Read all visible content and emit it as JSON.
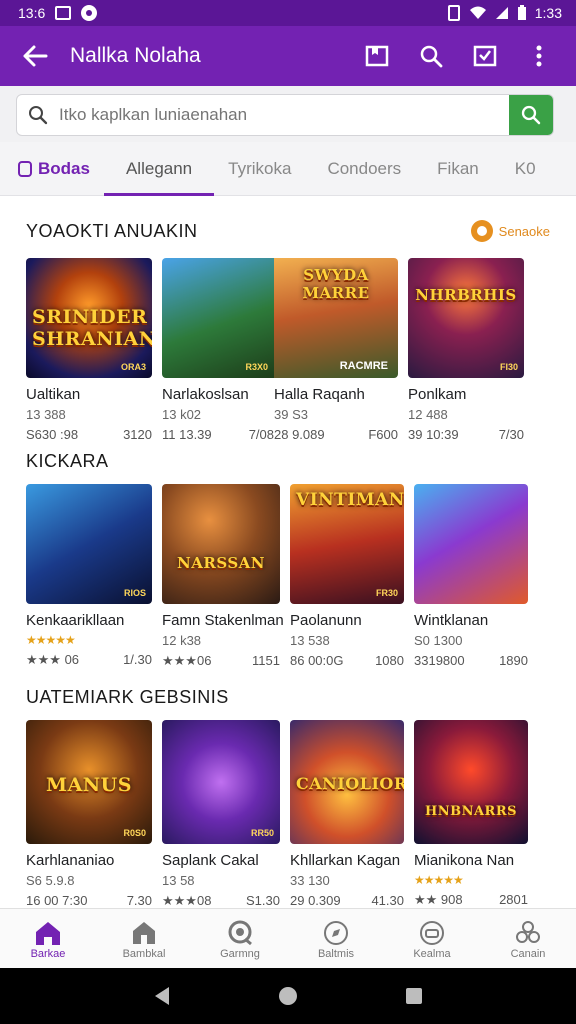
{
  "status_bar": {
    "time": "13:6",
    "right_time": "1:33"
  },
  "app_bar": {
    "title": "Nallka Nolaha"
  },
  "search": {
    "placeholder": "Itko kaplkan luniaenahan",
    "value": ""
  },
  "tabs": [
    {
      "label": "Bodas"
    },
    {
      "label": "Allegann"
    },
    {
      "label": "Tyrikoka"
    },
    {
      "label": "Condoers"
    },
    {
      "label": "Fikan"
    },
    {
      "label": "K0"
    }
  ],
  "sections": [
    {
      "title": "YOAOKTI ANUAKIN",
      "more_label": "Senaoke",
      "cards": [
        {
          "art": "SRINIDER SHRANIAN",
          "corner": "ORA3",
          "name": "Ualtikan",
          "sub": "13 388",
          "meta_left": "S630 :98",
          "meta_right": "3120"
        },
        {
          "art": "SWYDA MARRE",
          "corner": "R3X0",
          "name": "Narlakoslsan",
          "sub": "13 k02",
          "meta_left": "11 13.39",
          "meta_right": "7/08"
        },
        {
          "art": "",
          "corner": "RACMRE",
          "name": "Halla Raqanh",
          "sub": "39 S3",
          "meta_left": "28 9.089",
          "meta_right": "F600"
        },
        {
          "art": "NHRBRHIS",
          "corner": "FI30",
          "name": "Ponlkam",
          "sub": "12 488",
          "meta_left": "39 10:39",
          "meta_right": "7/30"
        }
      ]
    },
    {
      "title": "KICKARA",
      "cards": [
        {
          "art": "",
          "corner": "RIOS",
          "name": "Kenkaarikllaan",
          "stars": "★★★★★",
          "rating_left": "★★★ 06",
          "meta_right": "1/.30"
        },
        {
          "art": "NARSSAN",
          "corner": "",
          "name": "Famn Stakenlman",
          "sub": "12 k38",
          "rating_left": "★★★06",
          "meta_right": "1151"
        },
        {
          "art": "VINTIMAN",
          "corner": "FR30",
          "name": "Paolanunn",
          "sub": "13 538",
          "meta_left": "86 00:0G",
          "meta_right": "1080"
        },
        {
          "art": "",
          "corner": "",
          "name": "Wintklanan",
          "sub": "S0 1300",
          "meta_left": "3319800",
          "meta_right": "1890"
        }
      ]
    },
    {
      "title": "UATEMIARK GEBSINIS",
      "cards": [
        {
          "art": "MANUS",
          "corner": "R0S0",
          "name": "Karhlananiao",
          "sub": "S6 5.9.8",
          "meta_left": "16 00 7:30",
          "meta_right": "7.30"
        },
        {
          "art": "",
          "corner": "RR50",
          "name": "Saplank Cakal",
          "sub": "13 58",
          "rating_left": "★★★08",
          "meta_right": "S1.30"
        },
        {
          "art": "CANIOLIOR",
          "corner": "",
          "name": "Khllarkan Kagan",
          "sub": "33 130",
          "meta_left": "29 0.309",
          "meta_right": "41.30"
        },
        {
          "art": "HNBNARRS",
          "corner": "",
          "name": "Mianikona Nan",
          "stars": "★★★★★",
          "rating_left": "★★ 908",
          "meta_right": "2801"
        }
      ]
    }
  ],
  "bottom_nav": [
    {
      "label": "Barkae",
      "icon": "home-icon"
    },
    {
      "label": "Bambkal",
      "icon": "store-icon"
    },
    {
      "label": "Garmng",
      "icon": "chat-icon"
    },
    {
      "label": "Baltmis",
      "icon": "compass-icon"
    },
    {
      "label": "Kealma",
      "icon": "gamepad-icon"
    },
    {
      "label": "Canain",
      "icon": "group-icon"
    }
  ],
  "colors": {
    "accent": "#7322b2",
    "search_button": "#3aa146",
    "more_dot": "#e69020"
  }
}
